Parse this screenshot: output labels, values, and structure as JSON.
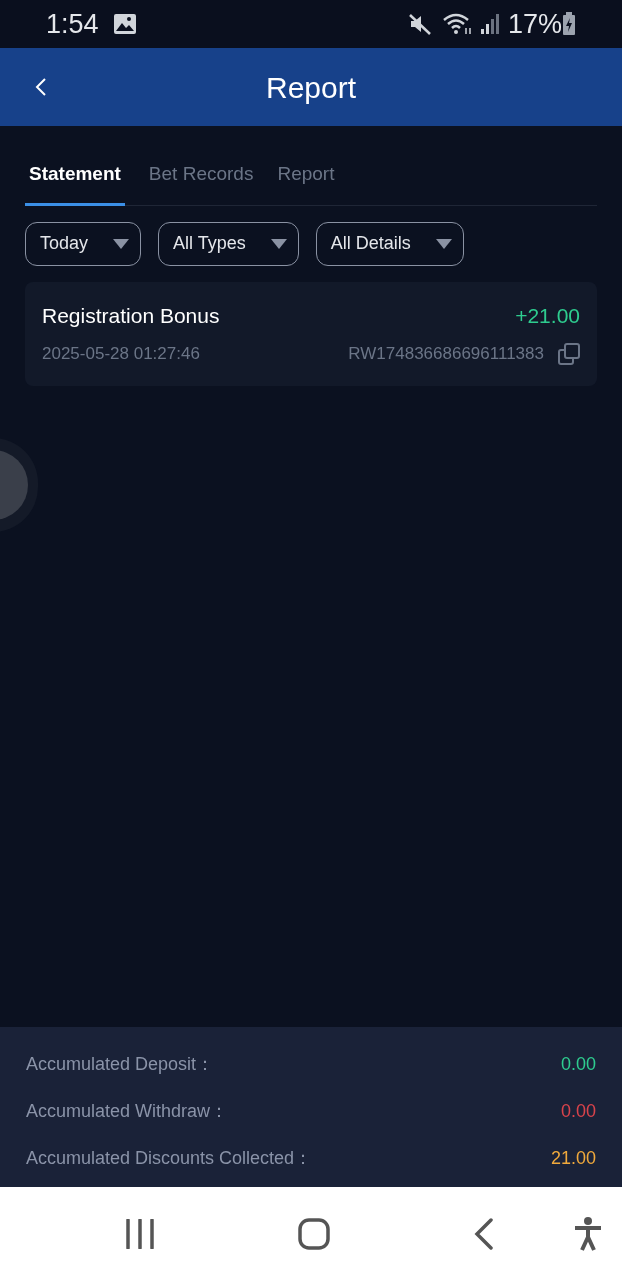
{
  "status_bar": {
    "time": "1:54",
    "battery": "17%"
  },
  "header": {
    "title": "Report"
  },
  "tabs": [
    {
      "label": "Statement",
      "selected": true
    },
    {
      "label": "Bet Records",
      "selected": false
    },
    {
      "label": "Report",
      "selected": false
    }
  ],
  "filters": [
    {
      "label": "Today"
    },
    {
      "label": "All Types"
    },
    {
      "label": "All Details"
    }
  ],
  "records": [
    {
      "title": "Registration Bonus",
      "amount": "+21.00",
      "time": "2025-05-28 01:27:46",
      "order_id": "RW174836686696111383"
    }
  ],
  "summary": [
    {
      "label": "Accumulated Deposit：",
      "value": "0.00",
      "color": "#2ecc8f"
    },
    {
      "label": "Accumulated Withdraw：",
      "value": "0.00",
      "color": "#d9434b"
    },
    {
      "label": "Accumulated Discounts Collected：",
      "value": "21.00",
      "color": "#f0a93c"
    }
  ]
}
